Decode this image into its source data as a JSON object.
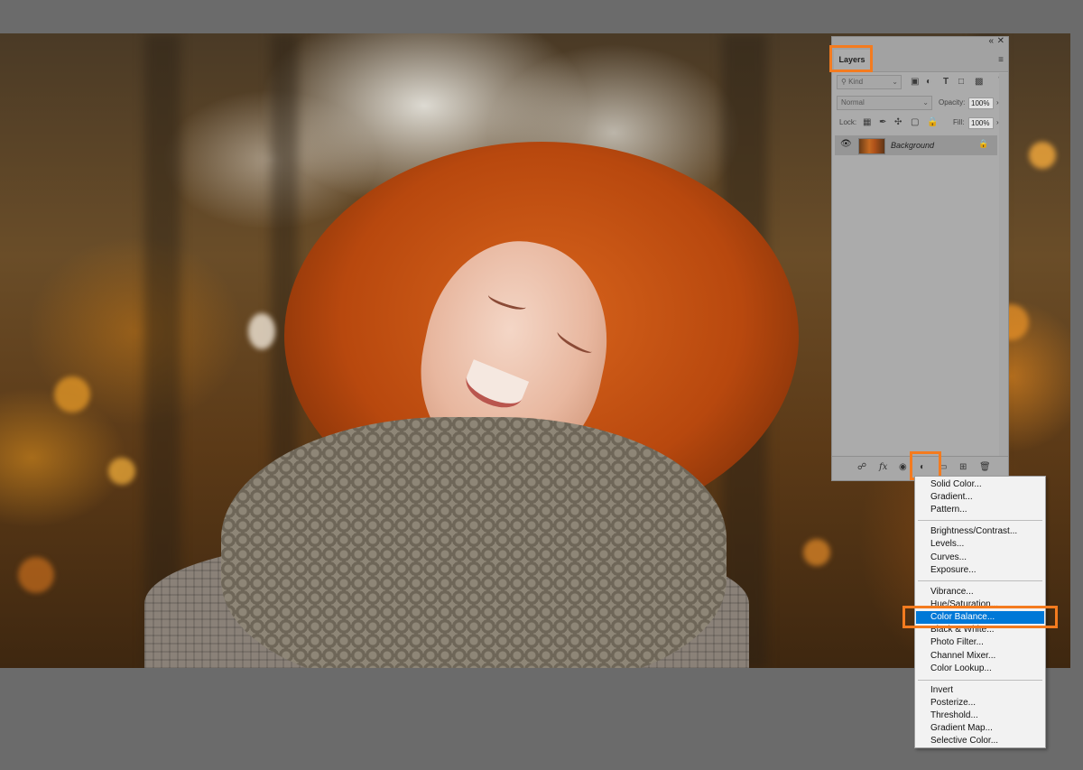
{
  "panel": {
    "tab_label": "Layers",
    "collapse_icon": "double-chevron-left-icon",
    "close_icon": "close-icon",
    "menu_icon": "hamburger-menu-icon",
    "filter": {
      "kind_label": "Kind",
      "icons": [
        "image-filter-icon",
        "adjustment-filter-icon",
        "type-filter-icon",
        "shape-filter-icon",
        "smart-object-filter-icon"
      ]
    },
    "blend_mode": "Normal",
    "opacity_label": "Opacity:",
    "opacity_value": "100%",
    "lock_label": "Lock:",
    "fill_label": "Fill:",
    "fill_value": "100%",
    "layers": [
      {
        "name": "Background",
        "visible": true,
        "locked": true
      }
    ],
    "bottom_buttons": [
      "link-layers-icon",
      "fx-icon",
      "add-mask-icon",
      "new-adjustment-layer-icon",
      "new-group-icon",
      "new-layer-icon",
      "delete-layer-icon"
    ],
    "fx_text": "fx"
  },
  "menu": {
    "groups": [
      [
        "Solid Color...",
        "Gradient...",
        "Pattern..."
      ],
      [
        "Brightness/Contrast...",
        "Levels...",
        "Curves...",
        "Exposure..."
      ],
      [
        "Vibrance...",
        "Hue/Saturation...",
        "Color Balance...",
        "Black & White...",
        "Photo Filter...",
        "Channel Mixer...",
        "Color Lookup..."
      ],
      [
        "Invert",
        "Posterize...",
        "Threshold...",
        "Gradient Map...",
        "Selective Color..."
      ]
    ],
    "selected": "Color Balance..."
  },
  "colors": {
    "highlight": "#f47b1f",
    "menu_selected": "#0078d7",
    "app_background": "#6b6b6b",
    "panel_background": "#ababab"
  }
}
